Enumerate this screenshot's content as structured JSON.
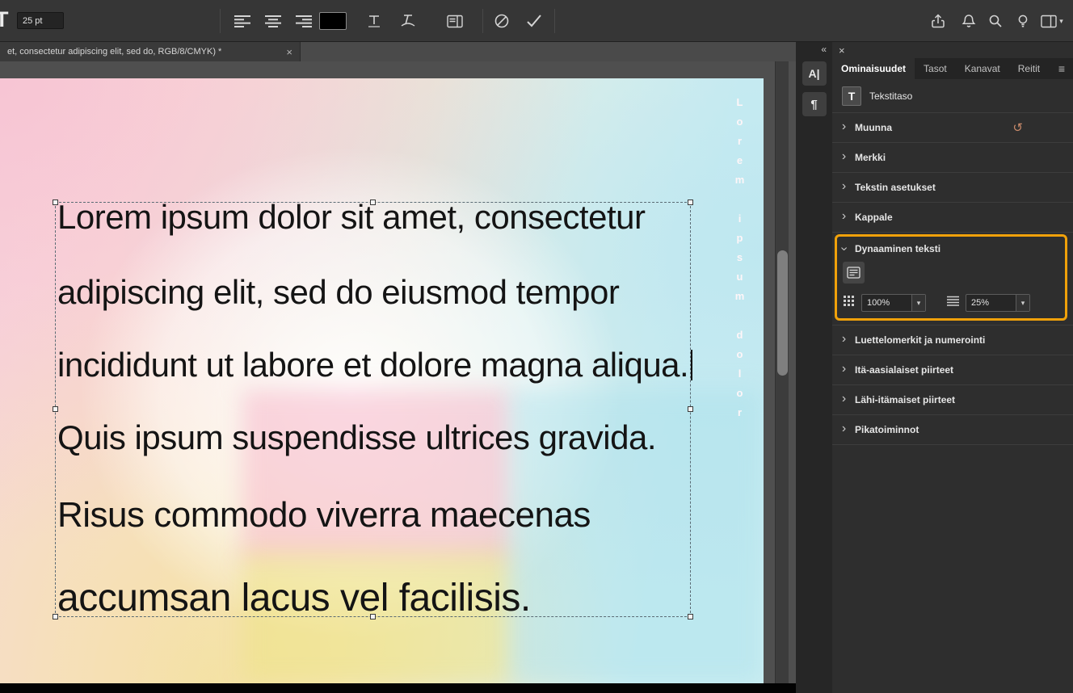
{
  "colors": {
    "highlight_orange": "#F0A10A",
    "panel_bg": "#2E2E2E",
    "canvas_text": "#141414"
  },
  "options_bar": {
    "tool_glyph": "T",
    "font_size_value": "25 pt"
  },
  "document": {
    "tab_label": "et, consectetur adipiscing elit, sed do, RGB/8/CMYK) *",
    "close_glyph": "×"
  },
  "canvas": {
    "text_lines": [
      "Lorem ipsum dolor sit amet, consectetur",
      "adipiscing elit, sed do eiusmod tempor",
      "incididunt ut labore et dolore magna aliqua.",
      "Quis ipsum suspendisse ultrices gravida.",
      "Risus commodo viverra maecenas",
      "accumsan lacus vel facilisis."
    ],
    "vertical_text": "Lorem ipsum dolor"
  },
  "dock": {
    "collapse_glyph": "«",
    "character_button": "A|",
    "paragraph_button": "¶"
  },
  "panel": {
    "close_glyph": "×",
    "menu_glyph": "≡",
    "chevron_glyph": "›",
    "dropdown_arrow": "▾",
    "reset_glyph": "↺",
    "tabs": [
      {
        "label": "Ominaisuudet",
        "active": true
      },
      {
        "label": "Tasot",
        "active": false
      },
      {
        "label": "Kanavat",
        "active": false
      },
      {
        "label": "Reitit",
        "active": false
      }
    ],
    "layer_type": {
      "thumb_glyph": "T",
      "label": "Tekstitaso"
    },
    "sections": [
      {
        "label": "Muunna"
      },
      {
        "label": "Merkki"
      },
      {
        "label": "Tekstin asetukset"
      },
      {
        "label": "Kappale"
      },
      {
        "label": "Dynaaminen teksti"
      },
      {
        "label": "Luettelomerkit ja numerointi"
      },
      {
        "label": "Itä-aasialaiset piirteet"
      },
      {
        "label": "Lähi-itämaiset piirteet"
      },
      {
        "label": "Pikatoiminnot"
      }
    ],
    "dynamic_text": {
      "scale_value": "100%",
      "spacing_value": "25%"
    }
  }
}
